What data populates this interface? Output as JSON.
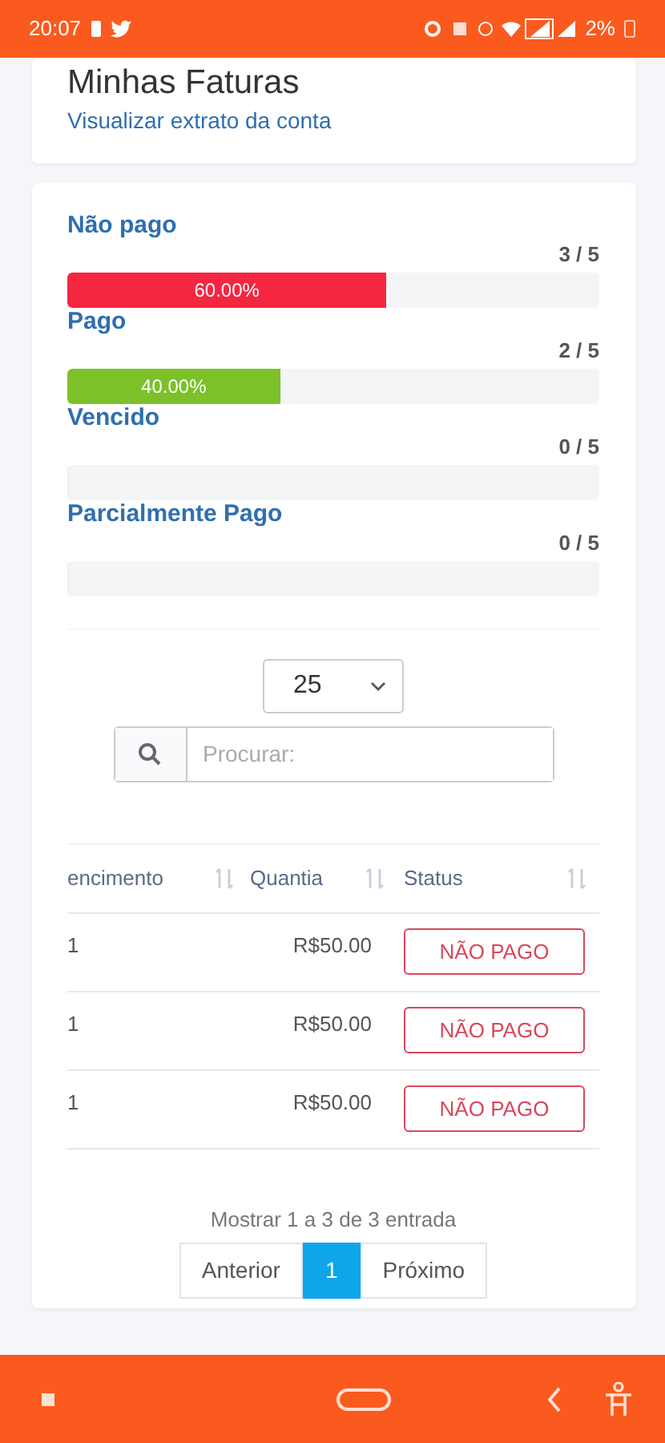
{
  "status_bar": {
    "time": "20:07",
    "battery": "2%"
  },
  "invoices_card": {
    "title": "Minhas Faturas",
    "link": "Visualizar extrato da conta"
  },
  "progress": [
    {
      "label": "Não pago",
      "count": "3 / 5",
      "level": 0.6,
      "percent": "60.00%",
      "color": "#f5263f"
    },
    {
      "label": "Pago",
      "count": "2 / 5",
      "level": 0.4,
      "percent": "40.00%",
      "color": "#7cc02a"
    },
    {
      "label": "Vencido",
      "count": "0 / 5",
      "level": 0
    },
    {
      "label": "Parcialmente Pago",
      "count": "0 / 5",
      "level": 0
    }
  ],
  "page_length": {
    "value": "25"
  },
  "search": {
    "placeholder": "Procurar:"
  },
  "table": {
    "columns": [
      "encimento",
      "Quantia",
      "Status"
    ],
    "rows": [
      {
        "column_1": "1",
        "amount": "R$50.00",
        "status": "NÃO PAGO"
      },
      {
        "column_1": "1",
        "amount": "R$50.00",
        "status": "NÃO PAGO"
      },
      {
        "column_1": "1",
        "amount": "R$50.00",
        "status": "NÃO PAGO"
      }
    ]
  },
  "info": "Mostrar 1 a 3 de 3 entrada",
  "pagination": [
    {
      "label": "Anterior",
      "selected": false
    },
    {
      "label": "1",
      "selected": true
    },
    {
      "label": "Próximo",
      "selected": false
    }
  ]
}
